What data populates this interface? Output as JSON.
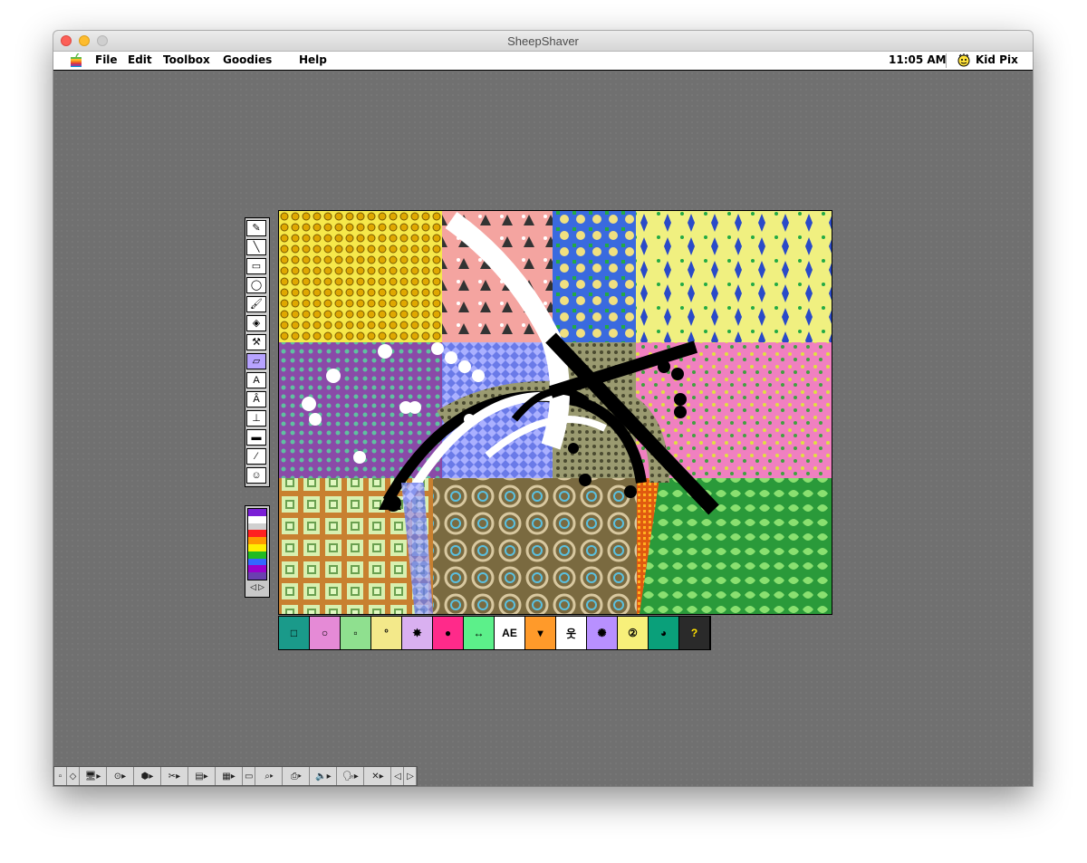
{
  "window": {
    "title": "SheepShaver"
  },
  "menubar": {
    "items": [
      "File",
      "Edit",
      "Toolbox",
      "Goodies",
      "Help"
    ],
    "clock": "11:05 AM",
    "app_name": "Kid Pix"
  },
  "toolbox": {
    "tools": [
      {
        "name": "wacky-pencil-tool",
        "glyph": "✎"
      },
      {
        "name": "line-tool",
        "glyph": "╲"
      },
      {
        "name": "rectangle-tool",
        "glyph": "▭"
      },
      {
        "name": "oval-tool",
        "glyph": "◯"
      },
      {
        "name": "wacky-brush-tool",
        "glyph": "🖌"
      },
      {
        "name": "paint-bucket-tool",
        "glyph": "◈"
      },
      {
        "name": "electric-mixer-tool",
        "glyph": "⚒"
      },
      {
        "name": "eraser-tool",
        "glyph": "▱"
      },
      {
        "name": "text-tool",
        "glyph": "A"
      },
      {
        "name": "alphabet-stamp-tool",
        "glyph": "Â"
      },
      {
        "name": "rubber-stamp-tool",
        "glyph": "⊥"
      },
      {
        "name": "moving-van-tool",
        "glyph": "▬"
      },
      {
        "name": "eyedropper-tool",
        "glyph": "⁄"
      },
      {
        "name": "undo-guy-tool",
        "glyph": "☺"
      }
    ],
    "selected_index": 7
  },
  "color_palette": {
    "colors": [
      "#7a1fd6",
      "#ffffff",
      "#d0d0d0",
      "#ff2020",
      "#ff9900",
      "#ffee00",
      "#22bb22",
      "#3366ff",
      "#9900cc",
      "#6a3fb0"
    ],
    "selected_color": "#7a1fd6"
  },
  "options_bar": {
    "options": [
      {
        "name": "square-eraser-option",
        "bg": "#1a9a8a",
        "glyph": "□"
      },
      {
        "name": "circle-eraser-option",
        "bg": "#e58ad6",
        "glyph": "○"
      },
      {
        "name": "small-square-eraser-option",
        "bg": "#8fe08f",
        "glyph": "▫"
      },
      {
        "name": "small-circle-eraser-option",
        "bg": "#f3e98a",
        "glyph": "°"
      },
      {
        "name": "firecracker-option",
        "bg": "#d9b0f0",
        "glyph": "✸"
      },
      {
        "name": "bubbles-option",
        "bg": "#ff2a8a",
        "glyph": "●"
      },
      {
        "name": "arrows-option",
        "bg": "#5cf08a",
        "glyph": "↔"
      },
      {
        "name": "letters-option",
        "bg": "#ffffff",
        "glyph": "AE"
      },
      {
        "name": "drop-option",
        "bg": "#ff9a2a",
        "glyph": "▾"
      },
      {
        "name": "stick-figure-option",
        "bg": "#ffffff",
        "glyph": "웃"
      },
      {
        "name": "black-hole-option",
        "bg": "#b890ff",
        "glyph": "✺"
      },
      {
        "name": "number-option",
        "bg": "#f7f07a",
        "glyph": "②"
      },
      {
        "name": "pac-man-option",
        "bg": "#0aa07a",
        "glyph": "◕"
      },
      {
        "name": "question-option",
        "bg": "#2a2a2a",
        "glyph": "?"
      }
    ]
  },
  "control_strip": {
    "segments": [
      "▫",
      "◇",
      "🖥▸",
      "⊙▸",
      "⬢▸",
      "✂▸",
      "▤▸",
      "▦▸",
      "▭",
      "⌕▸",
      "⎙▸",
      "🔈▸",
      "🗣▸",
      "✕▸",
      "◁",
      "▷"
    ]
  },
  "colors": {
    "desktop": "#707070",
    "canvas_border": "#000000",
    "selected_tool": "#b7a3ff"
  }
}
